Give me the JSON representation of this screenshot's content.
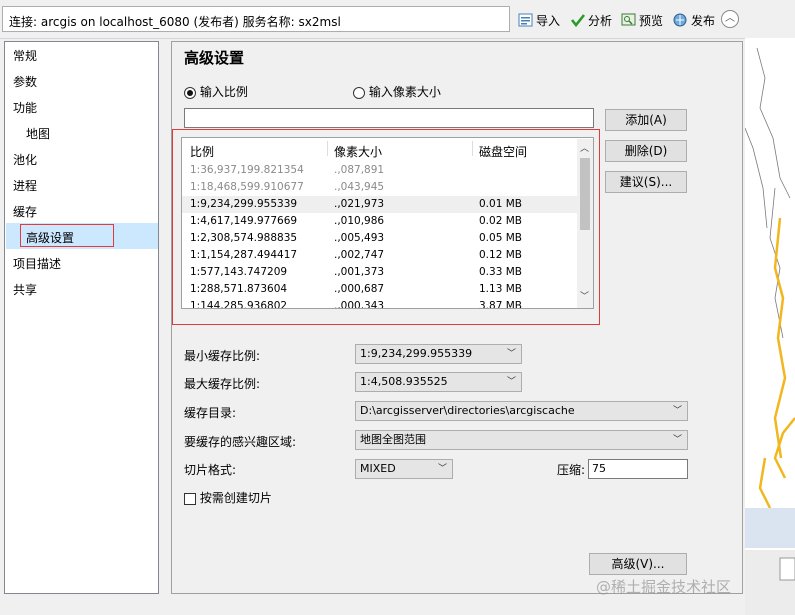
{
  "toolbar": {
    "connection_text": "连接: arcgis on localhost_6080 (发布者)    服务名称: sx2msl",
    "import_label": "导入",
    "analyze_label": "分析",
    "preview_label": "预览",
    "publish_label": "发布"
  },
  "sidebar": {
    "items": [
      {
        "label": "常规"
      },
      {
        "label": "参数"
      },
      {
        "label": "功能"
      },
      {
        "label": "地图"
      },
      {
        "label": "池化"
      },
      {
        "label": "进程"
      },
      {
        "label": "缓存"
      },
      {
        "label": "高级设置"
      },
      {
        "label": "项目描述"
      },
      {
        "label": "共享"
      }
    ]
  },
  "main": {
    "title": "高级设置",
    "radio_scale_label": "输入比例",
    "radio_pixel_label": "输入像素大小",
    "scale_input_value": "",
    "add_button": "添加(A)",
    "delete_button": "删除(D)",
    "suggest_button": "建议(S)...",
    "table": {
      "headers": [
        "比例",
        "像素大小",
        "磁盘空间"
      ],
      "rows": [
        {
          "scale": "1:36,937,199.821354",
          "pixel": ".,087,891",
          "disk": ""
        },
        {
          "scale": "1:18,468,599.910677",
          "pixel": ".,043,945",
          "disk": ""
        },
        {
          "scale": "1:9,234,299.955339",
          "pixel": ".,021,973",
          "disk": "0.01 MB"
        },
        {
          "scale": "1:4,617,149.977669",
          "pixel": ".,010,986",
          "disk": "0.02 MB"
        },
        {
          "scale": "1:2,308,574.988835",
          "pixel": ".,005,493",
          "disk": "0.05 MB"
        },
        {
          "scale": "1:1,154,287.494417",
          "pixel": ".,002,747",
          "disk": "0.12 MB"
        },
        {
          "scale": "1:577,143.747209",
          "pixel": ".,001,373",
          "disk": "0.33 MB"
        },
        {
          "scale": "1:288,571.873604",
          "pixel": ".,000,687",
          "disk": "1.13 MB"
        },
        {
          "scale": "1:144,285.936802",
          "pixel": ".,000,343",
          "disk": "3.87 MB"
        }
      ]
    },
    "min_scale_label": "最小缓存比例:",
    "min_scale_value": "1:9,234,299.955339",
    "max_scale_label": "最大缓存比例:",
    "max_scale_value": "1:4,508.935525",
    "cache_dir_label": "缓存目录:",
    "cache_dir_value": "D:\\arcgisserver\\directories\\arcgiscache",
    "aoi_label": "要缓存的感兴趣区域:",
    "aoi_value": "地图全图范围",
    "tile_format_label": "切片格式:",
    "tile_format_value": "MIXED",
    "compression_label": "压缩:",
    "compression_value": "75",
    "on_demand_label": "按需创建切片",
    "advanced_button": "高级(V)..."
  },
  "watermark": "@稀土掘金技术社区",
  "colors": {
    "selection_bg": "#cce8ff",
    "highlight_border": "#e03c3c",
    "map_line": "#f2b61f"
  }
}
